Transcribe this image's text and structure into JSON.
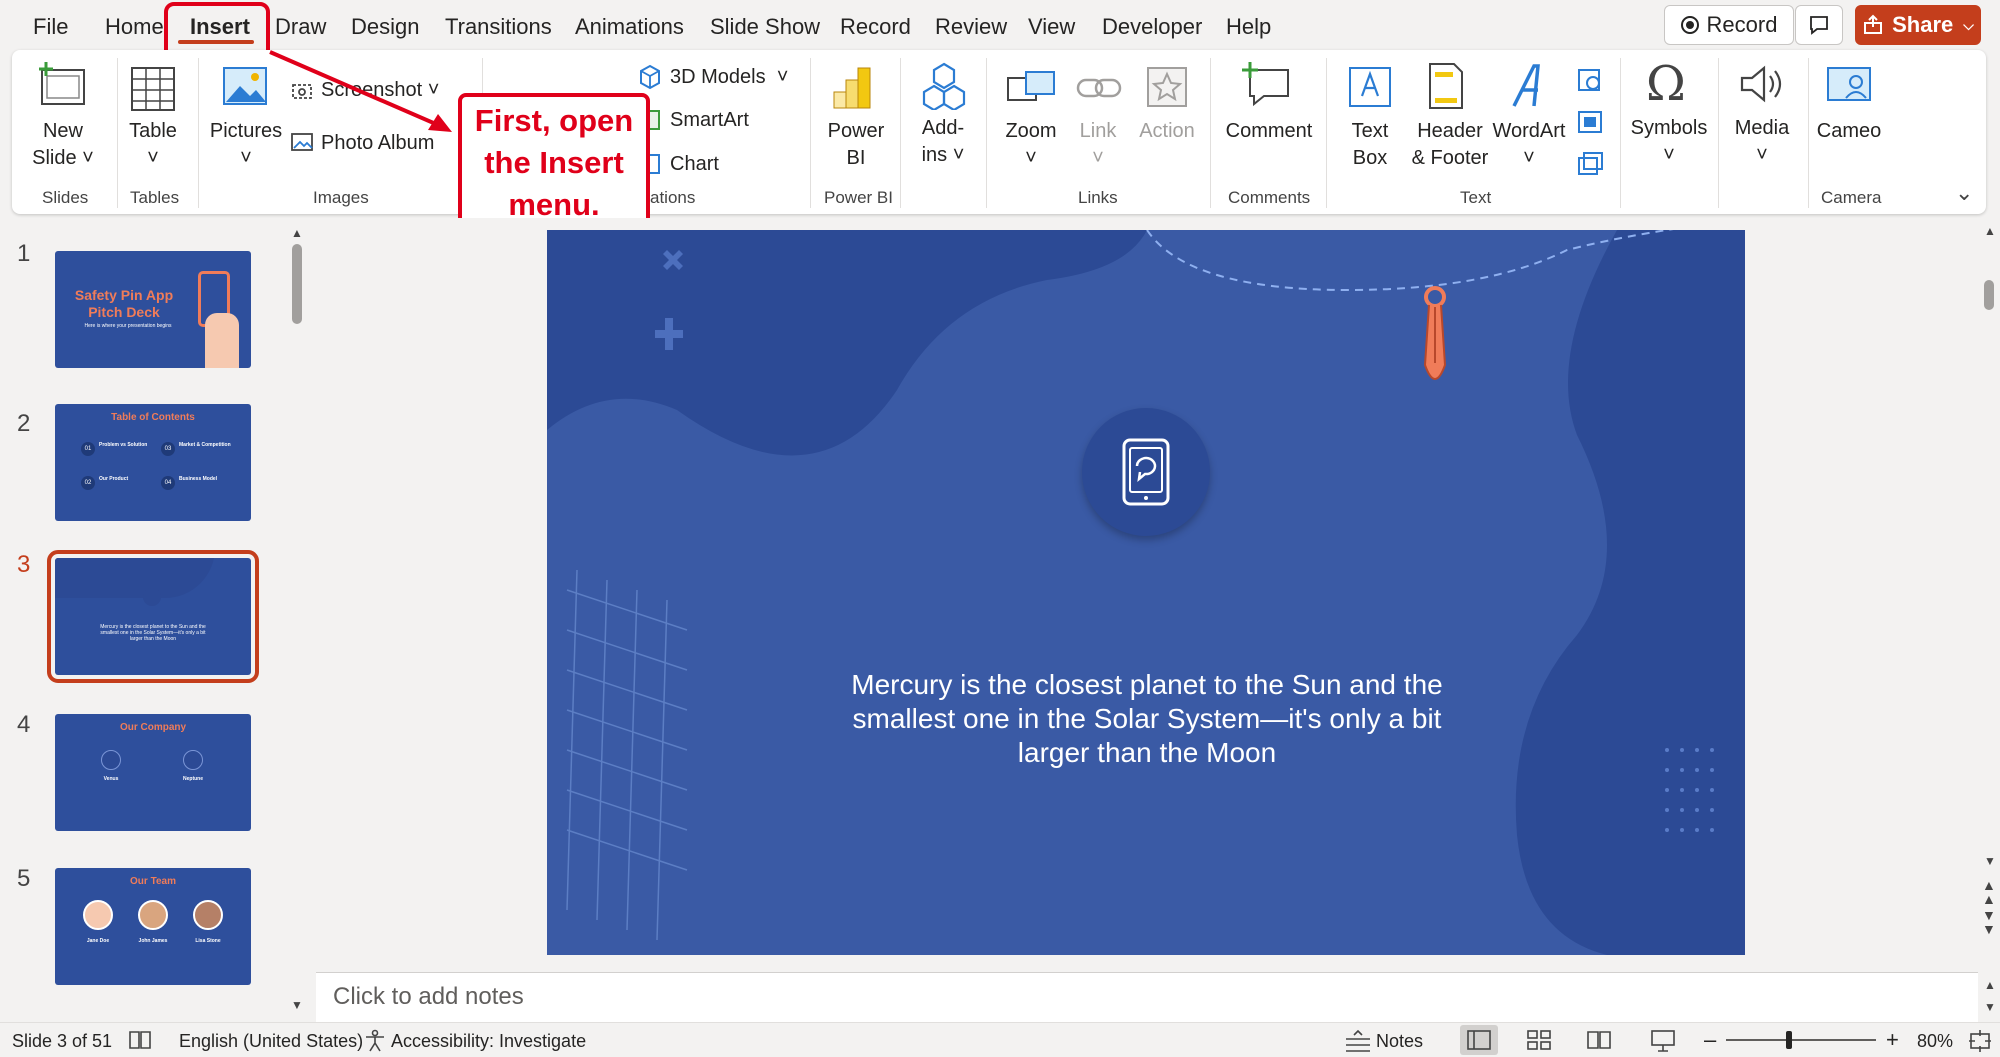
{
  "menu": {
    "tabs": [
      "File",
      "Home",
      "Insert",
      "Draw",
      "Design",
      "Transitions",
      "Animations",
      "Slide Show",
      "Record",
      "Review",
      "View",
      "Developer",
      "Help"
    ],
    "active_tab": "Insert",
    "record_label": "Record",
    "share_label": "Share"
  },
  "ribbon": {
    "new_slide_1": "New",
    "new_slide_2": "Slide",
    "table": "Table",
    "pictures": "Pictures",
    "screenshot": "Screenshot",
    "photo_album": "Photo Album",
    "models_3d": "3D Models",
    "smartart": "SmartArt",
    "chart": "Chart",
    "power_bi_1": "Power",
    "power_bi_2": "BI",
    "addins_1": "Add-",
    "addins_2": "ins",
    "zoom": "Zoom",
    "link": "Link",
    "action": "Action",
    "comment": "Comment",
    "textbox_1": "Text",
    "textbox_2": "Box",
    "header_1": "Header",
    "header_2": "& Footer",
    "wordart": "WordArt",
    "symbols": "Symbols",
    "media": "Media",
    "cameo": "Cameo",
    "groups": {
      "slides": "Slides",
      "tables": "Tables",
      "images": "Images",
      "illustrations": "ations",
      "power_bi": "Power BI",
      "links": "Links",
      "comments": "Comments",
      "text": "Text",
      "camera": "Camera"
    }
  },
  "callout": {
    "line1": "First, open",
    "line2": "the Insert",
    "line3": "menu."
  },
  "thumbnails": [
    {
      "num": "1",
      "title_1": "Safety Pin App",
      "title_2": "Pitch Deck",
      "sub": "Here is where your presentation begins"
    },
    {
      "num": "2",
      "title": "Table of Contents",
      "items": [
        "01",
        "02",
        "03",
        "04"
      ],
      "labels": [
        "Problem vs Solution",
        "Our Product",
        "Market & Competition",
        "Business Model"
      ]
    },
    {
      "num": "3",
      "text": "Mercury is the closest planet to the Sun and the smallest one in the Solar System—it's only a bit larger than the Moon"
    },
    {
      "num": "4",
      "title": "Our Company",
      "labels": [
        "Venus",
        "Neptune"
      ]
    },
    {
      "num": "5",
      "title": "Our Team",
      "labels": [
        "Jane Doe",
        "John James",
        "Lisa Stone"
      ]
    }
  ],
  "slide": {
    "text": "Mercury is the closest planet to the Sun and the smallest one in the Solar System—it's only a bit larger than the Moon"
  },
  "notes_placeholder": "Click to add notes",
  "status": {
    "slide_info": "Slide 3 of 51",
    "language": "English (United States)",
    "accessibility": "Accessibility: Investigate",
    "notes": "Notes",
    "zoom": "80%"
  },
  "colors": {
    "accent": "#c43e1c",
    "callout": "#e0001a",
    "slide_bg": "#3a5aa5",
    "slide_dark": "#2c4a95",
    "pin": "#f07c59"
  }
}
